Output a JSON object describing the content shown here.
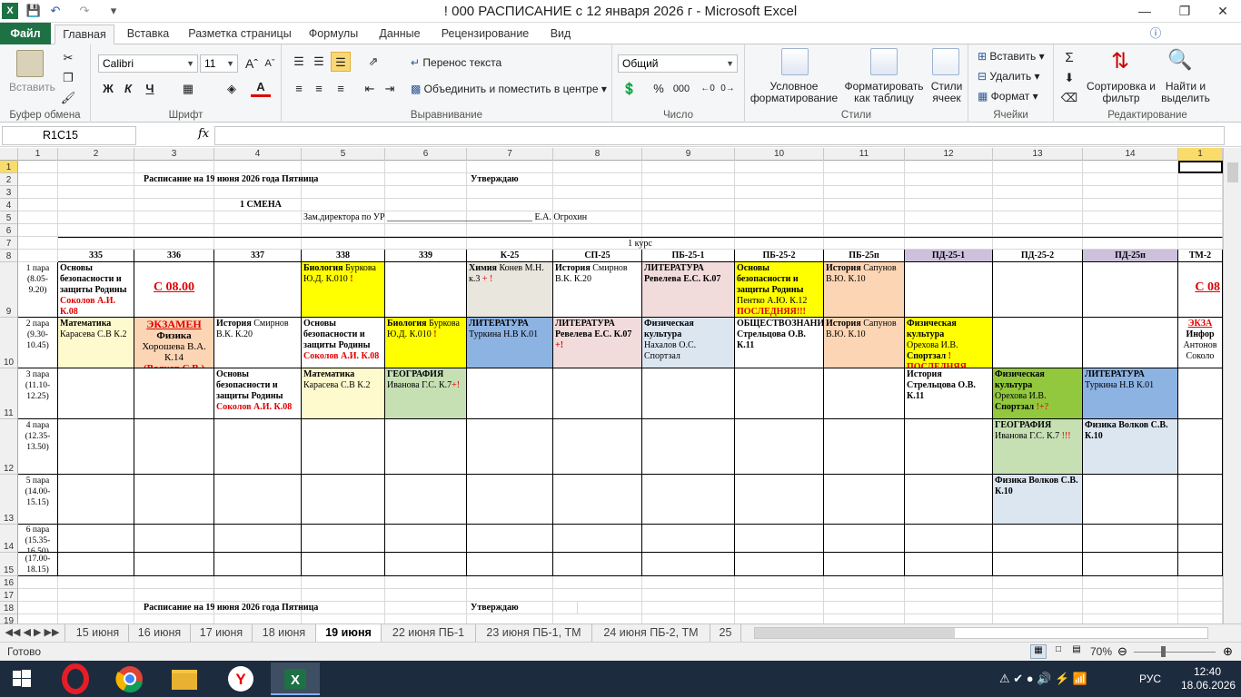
{
  "window": {
    "title": "! 000 РАСПИСАНИЕ с 12 января 2026 г  -  Microsoft Excel"
  },
  "ribbon_tabs": [
    "Файл",
    "Главная",
    "Вставка",
    "Разметка страницы",
    "Формулы",
    "Данные",
    "Рецензирование",
    "Вид"
  ],
  "ribbon": {
    "clipboard": {
      "paste": "Вставить",
      "label": "Буфер обмена"
    },
    "font": {
      "name": "Calibri",
      "size": "11",
      "label": "Шрифт",
      "bold": "Ж",
      "italic": "К",
      "underline": "Ч"
    },
    "alignment": {
      "wrap": "Перенос текста",
      "merge": "Объединить и поместить в центре",
      "label": "Выравнивание"
    },
    "number": {
      "format": "Общий",
      "label": "Число",
      "percent": "%",
      "thousands": "000"
    },
    "styles": {
      "cond": "Условное форматирование",
      "table": "Форматировать как таблицу",
      "cell": "Стили ячеек",
      "label": "Стили"
    },
    "cells": {
      "insert": "Вставить",
      "delete": "Удалить",
      "format": "Формат",
      "label": "Ячейки"
    },
    "editing": {
      "sort": "Сортировка и фильтр",
      "find": "Найти и выделить",
      "label": "Редактирование",
      "sum": "Σ"
    }
  },
  "formula_bar": {
    "namebox": "R1C15",
    "fx": "fx",
    "value": ""
  },
  "columns": [
    "1",
    "2",
    "3",
    "4",
    "5",
    "6",
    "7",
    "8",
    "9",
    "10",
    "11",
    "12",
    "13",
    "14",
    "1"
  ],
  "rows": [
    "1",
    "2",
    "3",
    "4",
    "5",
    "6",
    "7",
    "8",
    "9",
    "10",
    "11",
    "12",
    "13",
    "14",
    "15",
    "16",
    "17",
    "18",
    "19"
  ],
  "sheet": {
    "title1": "Расписание на 19 июня 2026 года  Пятница",
    "approve": "Утверждаю",
    "shift": "1 СМЕНА",
    "deputy": "Зам.директора по УР  ________________________________ Е.А. Огрохин",
    "course": "1 курс",
    "groups": [
      "335",
      "336",
      "337",
      "338",
      "339",
      "К-25",
      "СП-25",
      "ПБ-25-1",
      "ПБ-25-2",
      "ПБ-25п",
      "ПД-25-1",
      "ПД-25-2",
      "ПД-25п",
      "ТМ-2"
    ],
    "pairs": [
      "1 пара (8.05-9.20)",
      "2 пара (9.30-10.45)",
      "3 пара (11.10-12.25)",
      "4 пара (12.35-13.50)",
      "5 пара (14.00-15.15)",
      "6 пара (15.35-16.50)",
      "(17.00-18.15)"
    ],
    "c": {
      "r1_335a": "Основы безопасности и защиты Родины",
      "r1_335b": "Соколов А.И. К.08",
      "r1_336": "С 08.00",
      "r1_338a": "Биология",
      "r1_338b": " Буркова Ю.Д. К.010 ",
      "r1_338c": "!",
      "r1_k25a": "Химия",
      "r1_k25b": " Конев М.Н. к.3 ",
      "r1_k25c": "+ !",
      "r1_sp25a": "История",
      "r1_sp25b": " Смирнов В.К. К.20",
      "r1_pb1a": "ЛИТЕРАТУРА",
      "r1_pb1b": "Ревелева Е.С. К.07",
      "r1_pb2a": "Основы  безопасности и защиты Родины",
      "r1_pb2b": "Пентко А.Ю. К.12",
      "r1_pb2c": "ПОСЛЕДНЯЯ!!!",
      "r1_pbpa": "История",
      "r1_pbpb": " Сапунов В.Ю. К.10",
      "r1_tm": "С 08",
      "r2_335a": "Математика",
      "r2_335b": "Карасева С.В К.2",
      "r2_336a": "ЭКЗАМЕН",
      "r2_336b": "Физика",
      "r2_336c": "Хорошева В.А. К.14",
      "r2_336d": "(Волков С.В.)",
      "r2_337a": "История",
      "r2_337b": " Смирнов В.К. К.20",
      "r2_338a": "Основы безопасности и защиты Родины",
      "r2_338b": "Соколов А.И. К.08",
      "r2_339a": "Биология",
      "r2_339b": " Буркова Ю.Д. К.010 ",
      "r2_339c": "!",
      "r2_k25a": "ЛИТЕРАТУРА",
      "r2_k25b": "Туркина Н.В К.01",
      "r2_sp25a": "ЛИТЕРАТУРА",
      "r2_sp25b": "Ревелева Е.С. К.07 ",
      "r2_sp25c": "+!",
      "r2_pb1a": "Физическая культура",
      "r2_pb1b": "Нахалов О.С. Спортзал",
      "r2_pb2": "ОБЩЕСТВОЗНАНИЕ Стрельцова О.В. К.11",
      "r2_pbpa": "История",
      "r2_pbpb": " Сапунов В.Ю. К.10",
      "r2_pd1a": "Физическая культура",
      "r2_pd1b": "Орехова И.В.",
      "r2_pd1c": "Спортзал ",
      "r2_pd1d": "!",
      "r2_pd1e": "ПОСЛЕДНЯЯ",
      "r2_tma": "ЭКЗА",
      "r2_tmb": "Инфор",
      "r2_tmc": "Антонов",
      "r2_tmd": "Соколо",
      "r3_337a": "Основы безопасности и защиты Родины",
      "r3_337b": "Соколов А.И. К.08",
      "r3_338a": "Математика",
      "r3_338b": "Карасева С.В К.2",
      "r3_339a": "ГЕОГРАФИЯ",
      "r3_339b": "Иванова Г.С. К.7",
      "r3_339c": "+!",
      "r3_pd1": "История Стрельцова О.В. К.11",
      "r3_pd2a": "Физическая культура",
      "r3_pd2b": "Орехова И.В.",
      "r3_pd2c": "Спортзал ",
      "r3_pd2d": "!+?",
      "r3_pdpa": "ЛИТЕРАТУРА",
      "r3_pdpb": " Туркина Н.В К.01",
      "r4_pd2a": "ГЕОГРАФИЯ",
      "r4_pd2b": " Иванова Г.С. К.7 ",
      "r4_pd2c": "!!!",
      "r4_pdp": "Физика   Волков С.В. К.10",
      "r5_pd2": "Физика   Волков С.В. К.10"
    }
  },
  "sheet_tabs": [
    "15 июня",
    "16 июня",
    "17 июня",
    "18 июня",
    "19 июня",
    "22 июня ПБ-1",
    "23 июня ПБ-1, ТМ",
    "24 июня ПБ-2, ТМ",
    "25"
  ],
  "status": {
    "ready": "Готово",
    "zoom": "70%"
  },
  "taskbar": {
    "lang": "РУС",
    "time": "12:40",
    "date": "18.06.2026"
  },
  "colors": {
    "excel_green": "#1e7145",
    "yellow": "#ffff00",
    "light_yellow": "#fff9c4",
    "orange": "#fcd5b4",
    "blue": "#8db3e2",
    "light_blue": "#dce6f1",
    "green": "#c6e5b3",
    "olive": "#9acd32"
  }
}
